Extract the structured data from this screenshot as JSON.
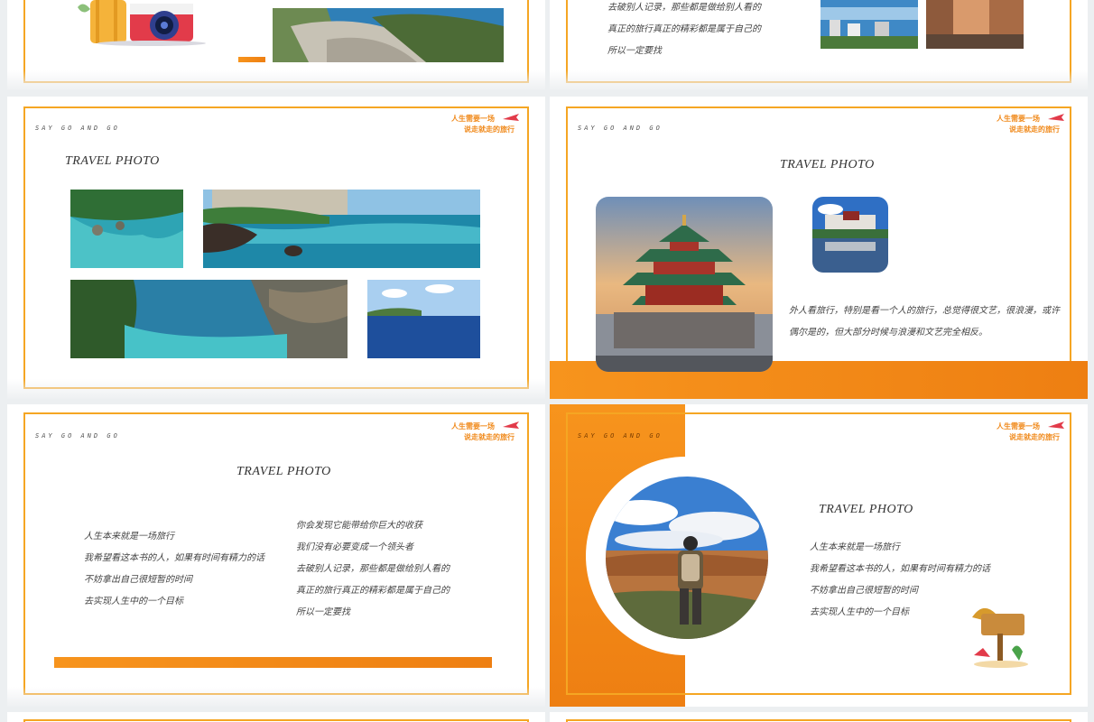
{
  "brand": {
    "tagline": "SAY GO AND GO",
    "logo_line1": "人生需要一场",
    "logo_line2": "说走就走的旅行"
  },
  "slide_top_right": {
    "lines": [
      "去破别人记录，那些都是做给别人看的",
      "真正的旅行真正的精彩都是属于自己的",
      "所以一定要找"
    ]
  },
  "slide_photos_grid": {
    "title": "TRAVEL  PHOTO"
  },
  "slide_xian": {
    "title": "TRAVEL  PHOTO",
    "text": "外人看旅行，特别是看一个人的旅行，总觉得很文艺，很浪漫，或许偶尔是的，但大部分时候与浪漫和文艺完全相反。"
  },
  "slide_text": {
    "title": "TRAVEL  PHOTO",
    "left_lines": [
      "人生本来就是一场旅行",
      "我希望看这本书的人，如果有时间有精力的话",
      "不妨拿出自己很短暂的时间",
      "去实现人生中的一个目标"
    ],
    "right_lines": [
      "你会发现它能带给你巨大的收获",
      "我们没有必要变成一个领头者",
      "去破别人记录，那些都是做给别人看的",
      "真正的旅行真正的精彩都是属于自己的",
      "所以一定要找"
    ]
  },
  "slide_hiker": {
    "title": "TRAVEL  PHOTO",
    "lines": [
      "人生本来就是一场旅行",
      "我希望看这本书的人，如果有时间有精力的话",
      "不妨拿出自己很短暂的时间",
      "去实现人生中的一个目标"
    ]
  },
  "colors": {
    "accent": "#f5a623",
    "orange": "#f08a1c"
  }
}
